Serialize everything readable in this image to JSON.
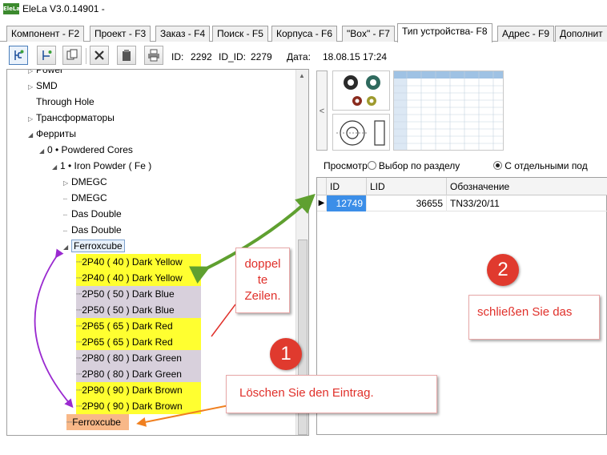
{
  "window": {
    "app_icon": "EleLa",
    "title": "EleLa V3.0.14901  -"
  },
  "tabs": [
    "Компонент - F2",
    "Проект - F3",
    "Заказ - F4",
    "Поиск - F5",
    "Корпуса - F6",
    "\"Box\" - F7",
    "Тип устройства- F8",
    "Адрес - F9",
    "Дополнит"
  ],
  "toolbar": {
    "id_label": "ID:",
    "id_value": "2292",
    "id_id_label": "ID_ID:",
    "id_id_value": "2279",
    "date_label": "Дата:",
    "date_value": "18.08.15 17:24"
  },
  "tree": {
    "power": "Power",
    "smd": "SMD",
    "through_hole": "Through Hole",
    "transformers": "Трансформаторы",
    "ferrites": "Ферриты",
    "powdered": "0 • Powdered Cores",
    "iron_powder": "1 • Iron Powder ( Fe )",
    "dmegc_1": "DMEGC",
    "dmegc_2": "DMEGC",
    "das_double_1": "Das Double",
    "das_double_2": "Das Double",
    "ferroxcube": "Ferroxcube",
    "items": [
      "2P40 ( 40 ) Dark Yellow",
      "2P40 ( 40 ) Dark Yellow",
      "2P50 ( 50 )  Dark Blue",
      "2P50 ( 50 )  Dark Blue",
      "2P65 ( 65 ) Dark Red",
      "2P65 ( 65 ) Dark Red",
      "2P80 ( 80 ) Dark Green",
      "2P80 ( 80 ) Dark Green",
      "2P90 ( 90 ) Dark Brown",
      "2P90 ( 90 ) Dark Brown"
    ],
    "ferroxcube_dup": "Ferroxcube"
  },
  "view": {
    "label": "Просмотр",
    "option1": "Выбор по разделу",
    "option2": "С отдельными под"
  },
  "grid": {
    "headers": [
      "ID",
      "LID",
      "Обозначение"
    ],
    "rows": [
      {
        "id": "12749",
        "lid": "36655",
        "designation": "TN33/20/11"
      }
    ]
  },
  "annotations": {
    "doppelte": "doppel te Zeilen.",
    "doppel_1": "doppel",
    "doppel_2": "te",
    "doppel_3": "Zeilen.",
    "n1": "1",
    "n2": "2",
    "schliessen": "schließen Sie das",
    "loeschen": "Löschen Sie den Eintrag."
  },
  "colors": {
    "highlight_yellow": "#ffff30",
    "highlight_purple": "#d8d0dc",
    "highlight_orange": "#f8b888",
    "callout_red": "#e0302a",
    "arrow_green": "#5fa030",
    "arrow_purple": "#9a2ad0",
    "arrow_orange": "#f08020"
  }
}
